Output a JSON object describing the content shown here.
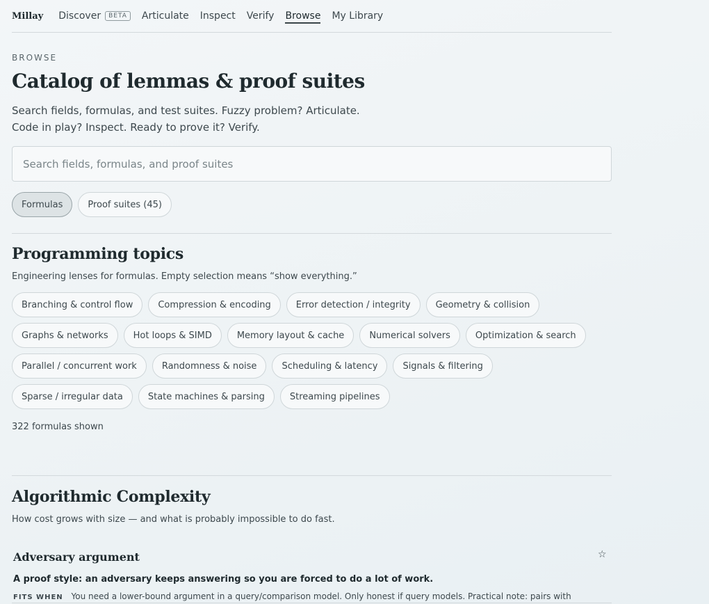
{
  "nav": {
    "brand": "Millay",
    "items": [
      {
        "label": "Discover",
        "badge": "BETA"
      },
      {
        "label": "Articulate"
      },
      {
        "label": "Inspect"
      },
      {
        "label": "Verify"
      },
      {
        "label": "Browse",
        "active": true
      },
      {
        "label": "My Library"
      }
    ]
  },
  "header": {
    "eyebrow": "BROWSE",
    "title": "Catalog of lemmas & proof suites",
    "subtitle_line1": "Search fields, formulas, and test suites. Fuzzy problem? Articulate.",
    "subtitle_line2": "Code in play? Inspect. Ready to prove it? Verify."
  },
  "search": {
    "placeholder": "Search fields, formulas, and proof suites",
    "value": ""
  },
  "tabs": [
    {
      "label": "Formulas",
      "selected": true
    },
    {
      "label": "Proof suites (45)",
      "selected": false
    }
  ],
  "topics": {
    "title": "Programming topics",
    "description": "Engineering lenses for formulas. Empty selection means “show everything.”",
    "items": [
      "Branching & control flow",
      "Compression & encoding",
      "Error detection / integrity",
      "Geometry & collision",
      "Graphs & networks",
      "Hot loops & SIMD",
      "Memory layout & cache",
      "Numerical solvers",
      "Optimization & search",
      "Parallel / concurrent work",
      "Randomness & noise",
      "Scheduling & latency",
      "Signals & filtering",
      "Sparse / irregular data",
      "State machines & parsing",
      "Streaming pipelines"
    ],
    "count_text": "322 formulas shown"
  },
  "section": {
    "title": "Algorithmic Complexity",
    "description": "How cost grows with size — and what is probably impossible to do fast.",
    "card": {
      "title": "Adversary argument",
      "star_icon": "star-outline-icon",
      "summary": "A proof style: an adversary keeps answering so you are forced to do a lot of work.",
      "fits_label": "FITS WHEN",
      "fits_text": "You need a lower-bound argument in a query/comparison model. Only honest if query models. Practical note: pairs with"
    }
  }
}
